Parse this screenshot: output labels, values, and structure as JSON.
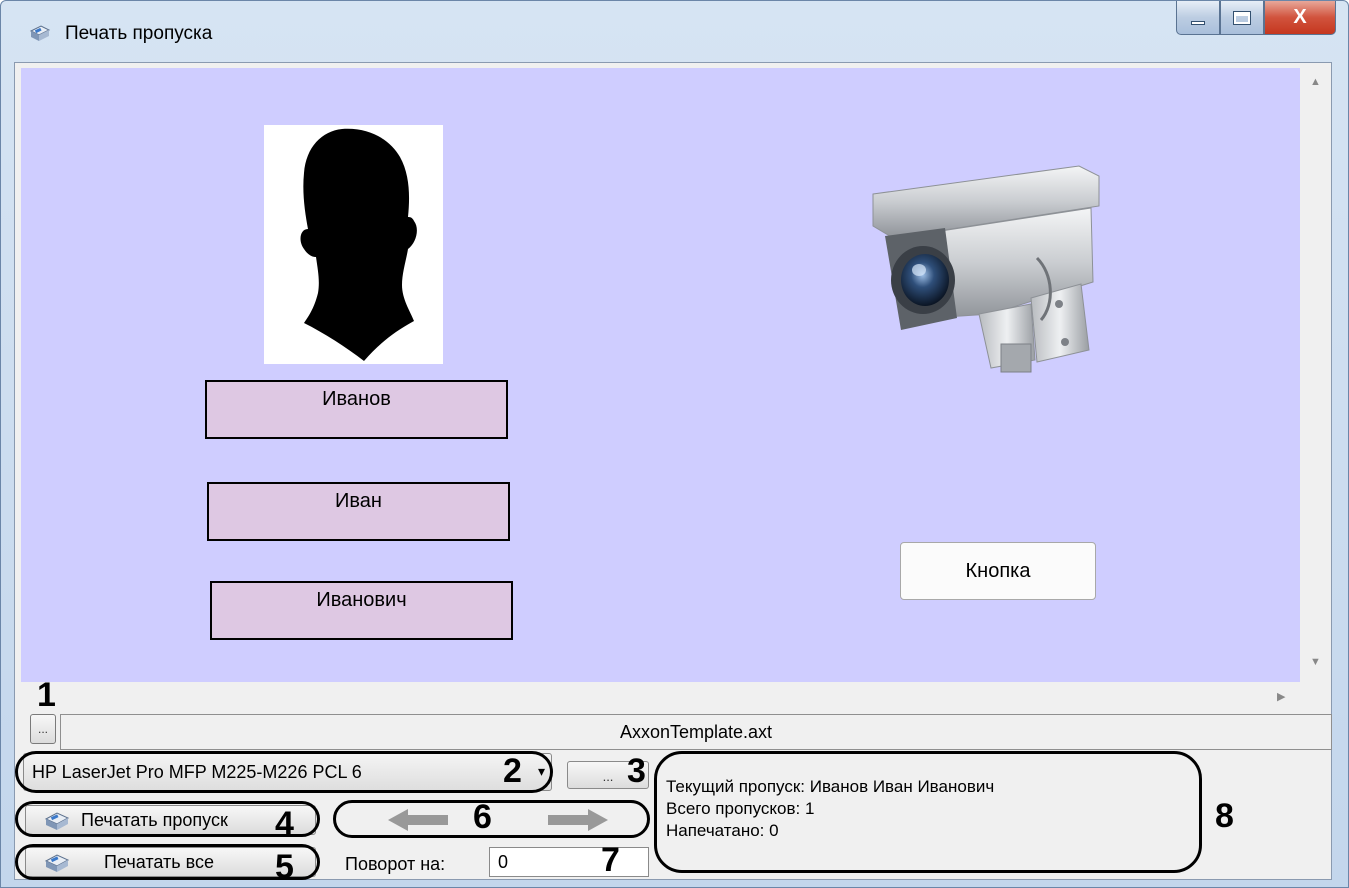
{
  "window": {
    "title": "Печать пропуска",
    "close_glyph": "X"
  },
  "card": {
    "photo": "silhouette-portrait",
    "fields": [
      "Иванов",
      "Иван",
      "Иванович"
    ],
    "button_label": "Кнопка",
    "image": "security-camera-icon"
  },
  "template": {
    "browse_label": "...",
    "file_name": "AxxonTemplate.axt"
  },
  "printer": {
    "selected": "HP LaserJet Pro MFP M225-M226 PCL 6",
    "settings_label": "..."
  },
  "actions": {
    "print_label": "Печатать пропуск",
    "print_all_label": "Печатать все",
    "rotation_label": "Поворот на:",
    "rotation_value": "0"
  },
  "info": {
    "current_pass": "Текущий пропуск: Иванов Иван Иванович",
    "total_passes": "Всего пропусков: 1",
    "printed": "Напечатано: 0"
  },
  "callout_numbers": [
    "1",
    "2",
    "3",
    "4",
    "5",
    "6",
    "7",
    "8"
  ],
  "colors": {
    "canvas_bg": "#cfcdff",
    "field_bg": "#dec8e3",
    "arrow_gray": "#999999"
  }
}
